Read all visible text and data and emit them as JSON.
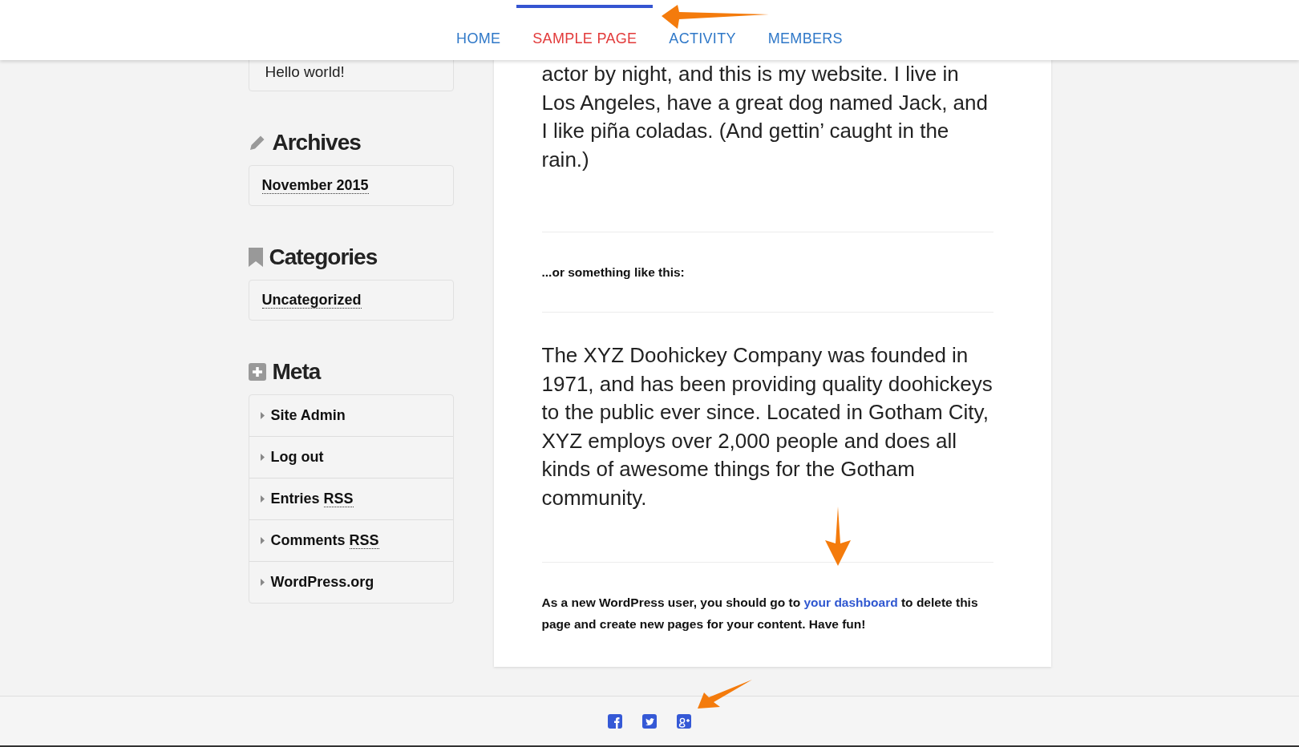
{
  "nav": {
    "items": [
      {
        "label": "HOME",
        "selected": false
      },
      {
        "label": "SAMPLE PAGE",
        "selected": true
      },
      {
        "label": "ACTIVITY",
        "selected": false
      },
      {
        "label": "MEMBERS",
        "selected": false
      }
    ]
  },
  "sidebar": {
    "recent_post": "Hello world!",
    "widgets": [
      {
        "title": "Archives",
        "kind": "links",
        "items": [
          {
            "label": "November 2015"
          }
        ]
      },
      {
        "title": "Categories",
        "kind": "links",
        "items": [
          {
            "label": "Uncategorized"
          }
        ]
      },
      {
        "title": "Meta",
        "kind": "menu",
        "items": [
          {
            "label": "Site Admin"
          },
          {
            "label": "Log out"
          },
          {
            "label": "Entries",
            "abbr": "RSS"
          },
          {
            "label": "Comments",
            "abbr": "RSS"
          },
          {
            "label": "WordPress.org"
          }
        ]
      }
    ]
  },
  "content": {
    "blocks": [
      {
        "kind": "large",
        "text": "actor by night, and this is my website. I live in Los Angeles, have a great dog named Jack, and I like piña coladas. (And gettin’ caught in the rain.)"
      },
      {
        "kind": "small",
        "text": "...or something like this:"
      },
      {
        "kind": "large",
        "text": "The XYZ Doohickey Company was founded in 1971, and has been providing quality doohickeys to the public ever since. Located in Gotham City, XYZ employs over 2,000 people and does all kinds of awesome things for the Gotham community."
      },
      {
        "kind": "small",
        "text": "As a new WordPress user, you should go to ",
        "link": "your dashboard",
        "after": " to delete this page and create new pages for your content. Have fun!"
      }
    ]
  },
  "footer": {
    "social": [
      {
        "kind": "facebook"
      },
      {
        "kind": "twitter"
      },
      {
        "kind": "google-plus"
      }
    ]
  }
}
